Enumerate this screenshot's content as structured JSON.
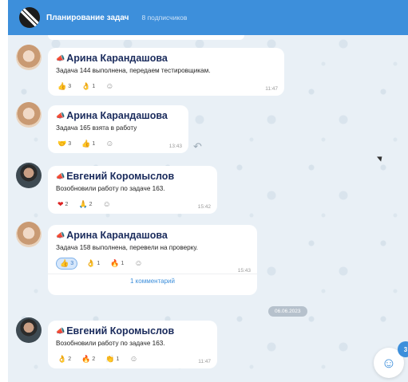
{
  "channel": {
    "title": "Планирование задач",
    "subscribers": "8 подписчиков"
  },
  "messages": [
    {
      "author": "Арина Карандашова",
      "text": "Задача 144 выполнена, передаем тестировщикам.",
      "time": "11:47",
      "reactions": [
        {
          "emoji": "👍",
          "count": "3"
        },
        {
          "emoji": "👌",
          "count": "1"
        }
      ]
    },
    {
      "author": "Арина Карандашова",
      "text": "Задача 165 взята в работу",
      "time": "13:43",
      "reactions": [
        {
          "emoji": "🤝",
          "count": "3"
        },
        {
          "emoji": "👍",
          "count": "1"
        }
      ]
    },
    {
      "author": "Евгений Коромыслов",
      "text": "Возобновили работу по задаче 163.",
      "time": "15:42",
      "reactions": [
        {
          "emoji": "❤",
          "count": "2"
        },
        {
          "emoji": "🙏",
          "count": "2"
        }
      ]
    },
    {
      "author": "Арина Карандашова",
      "text": "Задача 158 выполнена, перевели на проверку.",
      "time": "15:43",
      "reactions": [
        {
          "emoji": "👍",
          "count": "3"
        },
        {
          "emoji": "👌",
          "count": "1"
        },
        {
          "emoji": "🔥",
          "count": "1"
        }
      ],
      "comments": "1 комментарий"
    },
    {
      "author": "Евгений Коромыслов",
      "text": "Возобновили работу по задаче 163.",
      "time": "11:47",
      "reactions": [
        {
          "emoji": "👌",
          "count": "2"
        },
        {
          "emoji": "🔥",
          "count": "2"
        },
        {
          "emoji": "👏",
          "count": "1"
        }
      ]
    }
  ],
  "date_separator": "06.06.2023",
  "unread_badge": "3",
  "icons": {
    "channel_pin": "megaphone-icon",
    "add_reaction": "smile-icon",
    "reply": "reply-arrow-icon",
    "fab": "smile-icon"
  }
}
